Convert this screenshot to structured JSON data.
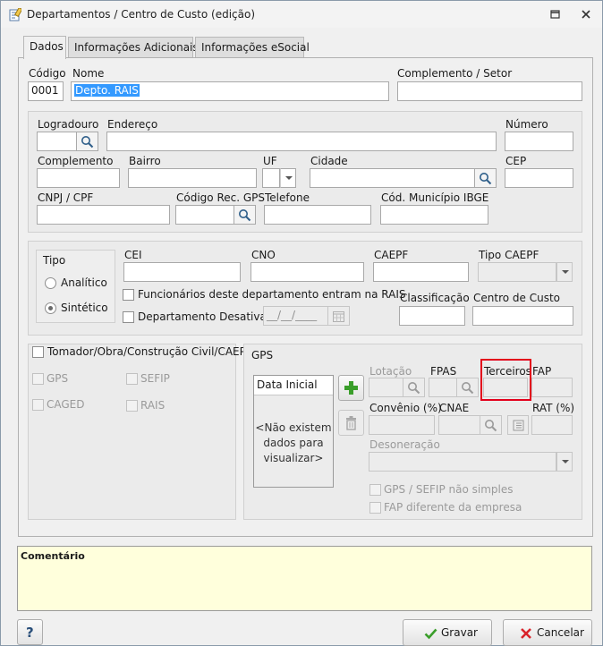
{
  "window": {
    "title": "Departamentos / Centro de Custo (edição)",
    "icons": {
      "app": "document-edit-icon",
      "restore": "restore-icon",
      "close": "close-icon"
    }
  },
  "tabs": [
    {
      "label": "Dados",
      "active": true
    },
    {
      "label": "Informações Adicionais",
      "active": false
    },
    {
      "label": "Informações eSocial",
      "active": false
    }
  ],
  "header": {
    "codigo_label": "Código",
    "codigo_value": "0001",
    "nome_label": "Nome",
    "nome_value": "Depto. RAIS",
    "complemento_setor_label": "Complemento / Setor",
    "complemento_setor_value": ""
  },
  "address": {
    "logradouro_label": "Logradouro",
    "logradouro_value": "",
    "endereco_label": "Endereço",
    "endereco_value": "",
    "numero_label": "Número",
    "numero_value": "",
    "complemento_label": "Complemento",
    "complemento_value": "",
    "bairro_label": "Bairro",
    "bairro_value": "",
    "uf_label": "UF",
    "uf_value": "",
    "cidade_label": "Cidade",
    "cidade_value": "",
    "cep_label": "CEP",
    "cep_value": "",
    "cnpj_cpf_label": "CNPJ / CPF",
    "cnpj_cpf_value": "",
    "codigo_rec_gps_label": "Código Rec. GPS",
    "codigo_rec_gps_value": "",
    "telefone_label": "Telefone",
    "telefone_value": "",
    "cod_municipio_ibge_label": "Cód. Município IBGE",
    "cod_municipio_ibge_value": ""
  },
  "tipo": {
    "label": "Tipo",
    "options": [
      {
        "label": "Analítico",
        "selected": false
      },
      {
        "label": "Sintético",
        "selected": true
      }
    ]
  },
  "registration": {
    "cei_label": "CEI",
    "cei_value": "",
    "cno_label": "CNO",
    "cno_value": "",
    "caepf_label": "CAEPF",
    "caepf_value": "",
    "tipo_caepf_label": "Tipo CAEPF",
    "tipo_caepf_value": "",
    "rais_checkbox_label": "Funcionários deste departamento entram na RAIS",
    "desativado_checkbox_label": "Departamento Desativado",
    "desativado_date_placeholder": "__/__/____",
    "classificacao_label": "Classificação",
    "classificacao_value": "",
    "centro_custo_label": "Centro de Custo",
    "centro_custo_value": ""
  },
  "tomador": {
    "label": "Tomador/Obra/Construção Civil/CAEPF",
    "options": [
      "GPS",
      "SEFIP",
      "CAGED",
      "RAIS"
    ]
  },
  "gps": {
    "title": "GPS",
    "grid_header": "Data Inicial",
    "grid_empty": [
      "<Não existem",
      "dados para",
      "visualizar>"
    ],
    "lotacao_label": "Lotação",
    "fpas_label": "FPAS",
    "terceiros_label": "Terceiros",
    "fap_label": "FAP",
    "convenio_label": "Convênio (%)",
    "cnae_label": "CNAE",
    "rat_label": "RAT (%)",
    "desoneracao_label": "Desoneração",
    "gps_sefip_label": "GPS / SEFIP não simples",
    "fap_diferente_label": "FAP diferente da empresa"
  },
  "comment": {
    "label": "Comentário",
    "value": ""
  },
  "footer": {
    "help_label": "?",
    "save_label": "Gravar",
    "cancel_label": "Cancelar"
  },
  "colors": {
    "highlight": "#e3001b",
    "selection": "#3399ff",
    "comment_bg": "#ffffdc",
    "save_check": "#3a9e2a",
    "cancel_x": "#d9232a"
  }
}
